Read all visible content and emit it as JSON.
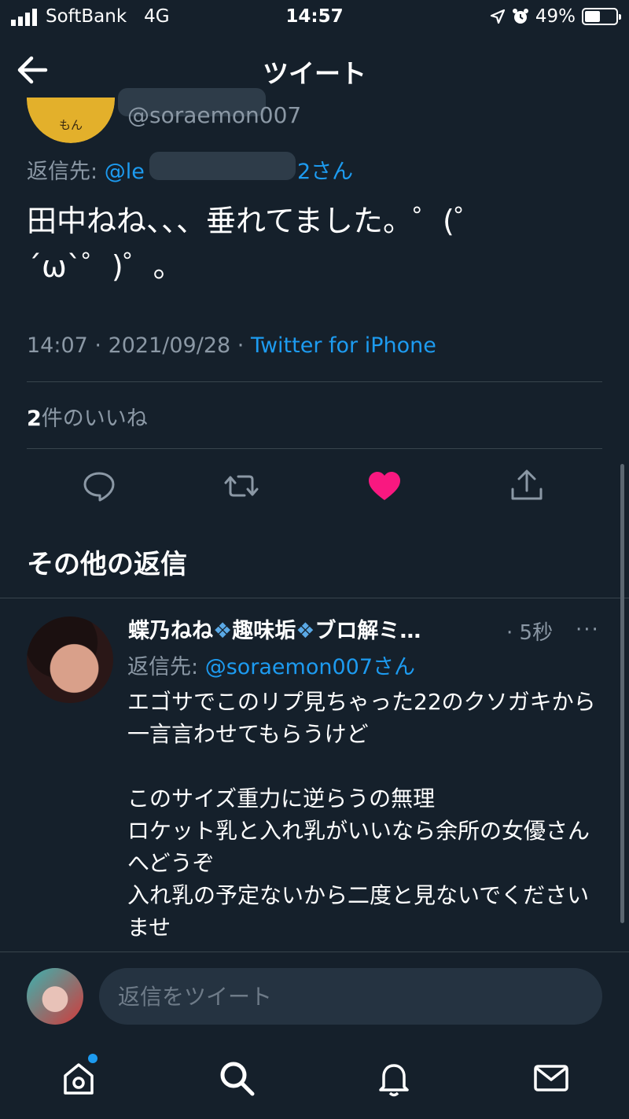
{
  "status_bar": {
    "carrier": "SoftBank",
    "network": "4G",
    "time": "14:57",
    "battery_percent": "49%",
    "battery_level": 0.49
  },
  "nav": {
    "title": "ツイート"
  },
  "tweet": {
    "author_handle": "@soraemon007",
    "avatar_text": "もん",
    "reply_to_prefix": "返信先: ",
    "reply_to_handle_start": "@le",
    "reply_to_handle_end": "2さん",
    "text": "田中ねね、、、垂れてました。゜(゜´ω`゜)゜。",
    "time": "14:07",
    "date": "2021/09/28",
    "source": "Twitter for iPhone",
    "likes_count": "2",
    "likes_label": "件のいいね"
  },
  "section": {
    "title": "その他の返信"
  },
  "reply": {
    "name_part1": "蝶乃ねね",
    "name_part2": "趣味垢",
    "name_part3": "ブロ解ミ…",
    "time": "· 5秒",
    "more": "···",
    "reply_to_prefix": "返信先: ",
    "reply_to_handle": "@soraemon007さん",
    "body": "エゴサでこのリプ見ちゃった22のクソガキから一言言わせてもらうけど\n\nこのサイズ重力に逆らうの無理\nロケット乳と入れ乳がいいなら余所の女優さんへどうぞ\n入れ乳の予定ないから二度と見ないでくださいませ"
  },
  "composer": {
    "placeholder": "返信をツイート"
  },
  "colors": {
    "background": "#15202b",
    "accent": "#1d9bf0",
    "like": "#f91880",
    "muted": "#8b98a5"
  }
}
